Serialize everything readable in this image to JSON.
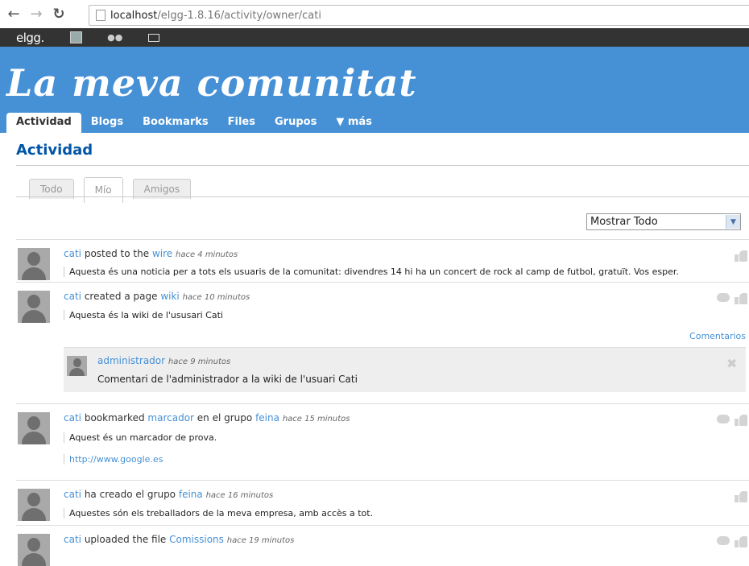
{
  "browser": {
    "url_host": "localhost",
    "url_path": "/elgg-1.8.16/activity/owner/cati"
  },
  "topbar": {
    "logo": "elgg."
  },
  "header": {
    "site_name": "La meva comunitat",
    "menu": [
      "Actividad",
      "Blogs",
      "Bookmarks",
      "Files",
      "Grupos",
      "▼ más"
    ]
  },
  "page": {
    "title": "Actividad",
    "tabs": [
      "Todo",
      "Mío",
      "Amigos"
    ],
    "filter_value": "Mostrar Todo"
  },
  "river": [
    {
      "user": "cati",
      "action": "posted to the",
      "target": "wire",
      "time": "hace 4 minutos",
      "message": "Aquesta és una noticia per a tots els usuaris de la comunitat: divendres 14 hi ha un concert de rock al camp de futbol, gratuït. Vos esper."
    },
    {
      "user": "cati",
      "action": "created a page",
      "target": "wiki",
      "time": "hace 10 minutos",
      "message": "Aquesta és la wiki de l'ususari Cati",
      "comments_label": "Comentarios",
      "comment": {
        "user": "administrador",
        "time": "hace 9 minutos",
        "text": "Comentari de l'administrador a la wiki de l'usuari Cati"
      }
    },
    {
      "user": "cati",
      "action": "bookmarked",
      "target": "marcador",
      "mid": "en el grupo",
      "group": "feina",
      "time": "hace 15 minutos",
      "message": "Aquest és un marcador de prova.",
      "url": "http://www.google.es"
    },
    {
      "user": "cati",
      "action": "ha creado el grupo",
      "target": "feina",
      "time": "hace 16 minutos",
      "message": "Aquestes són els treballadors de la meva empresa, amb accès a tot."
    },
    {
      "user": "cati",
      "action": "uploaded the file",
      "target": "Comissions",
      "time": "hace 19 minutos"
    }
  ]
}
